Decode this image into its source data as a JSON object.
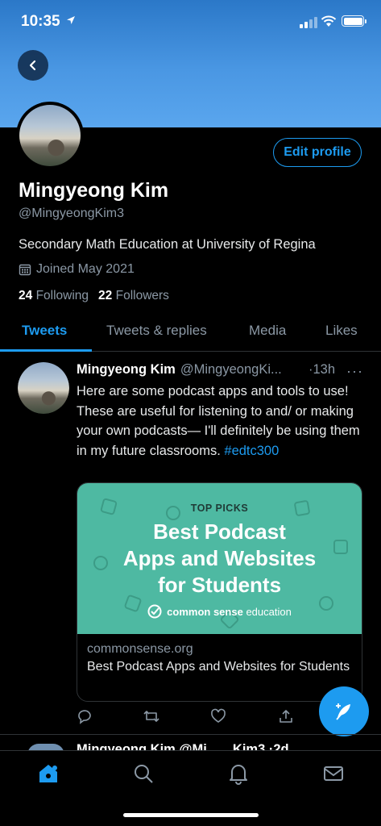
{
  "status_bar": {
    "time": "10:35"
  },
  "profile": {
    "name": "Mingyeong Kim",
    "handle": "@MingyeongKim3",
    "bio": "Secondary Math Education at University of Regina",
    "joined": "Joined May 2021",
    "following_count": "24",
    "following_label": "Following",
    "followers_count": "22",
    "followers_label": "Followers",
    "edit_label": "Edit profile"
  },
  "tabs": [
    {
      "label": "Tweets"
    },
    {
      "label": "Tweets & replies"
    },
    {
      "label": "Media"
    },
    {
      "label": "Likes"
    }
  ],
  "tweet": {
    "author": "Mingyeong Kim",
    "handle": "@MingyeongKi...",
    "time": "·13h",
    "more": "···",
    "text": "Here are some podcast apps and tools to use! These are useful for listening to and/ or making your own podcasts— I'll definitely be using them in my future classrooms. ",
    "hashtag": "#edtc300",
    "card": {
      "top_label": "TOP PICKS",
      "title_line1": "Best Podcast",
      "title_line2": "Apps and Websites",
      "title_line3": "for Students",
      "brand_bold": "common sense",
      "brand_light": "education",
      "domain": "commonsense.org",
      "description": "Best Podcast Apps and Websites for Students"
    }
  },
  "next_tweet_peek": {
    "text": "Mingyeong Kim @Mi...  ...Kim3 ·2d"
  },
  "colors": {
    "accent": "#1d9bf0",
    "banner": "#4a97e3",
    "card_bg": "#4eb9a2"
  },
  "icons": [
    "back-arrow-icon",
    "calendar-icon",
    "reply-icon",
    "retweet-icon",
    "like-icon",
    "share-icon",
    "compose-icon",
    "home-icon",
    "search-icon",
    "notifications-icon",
    "messages-icon"
  ]
}
